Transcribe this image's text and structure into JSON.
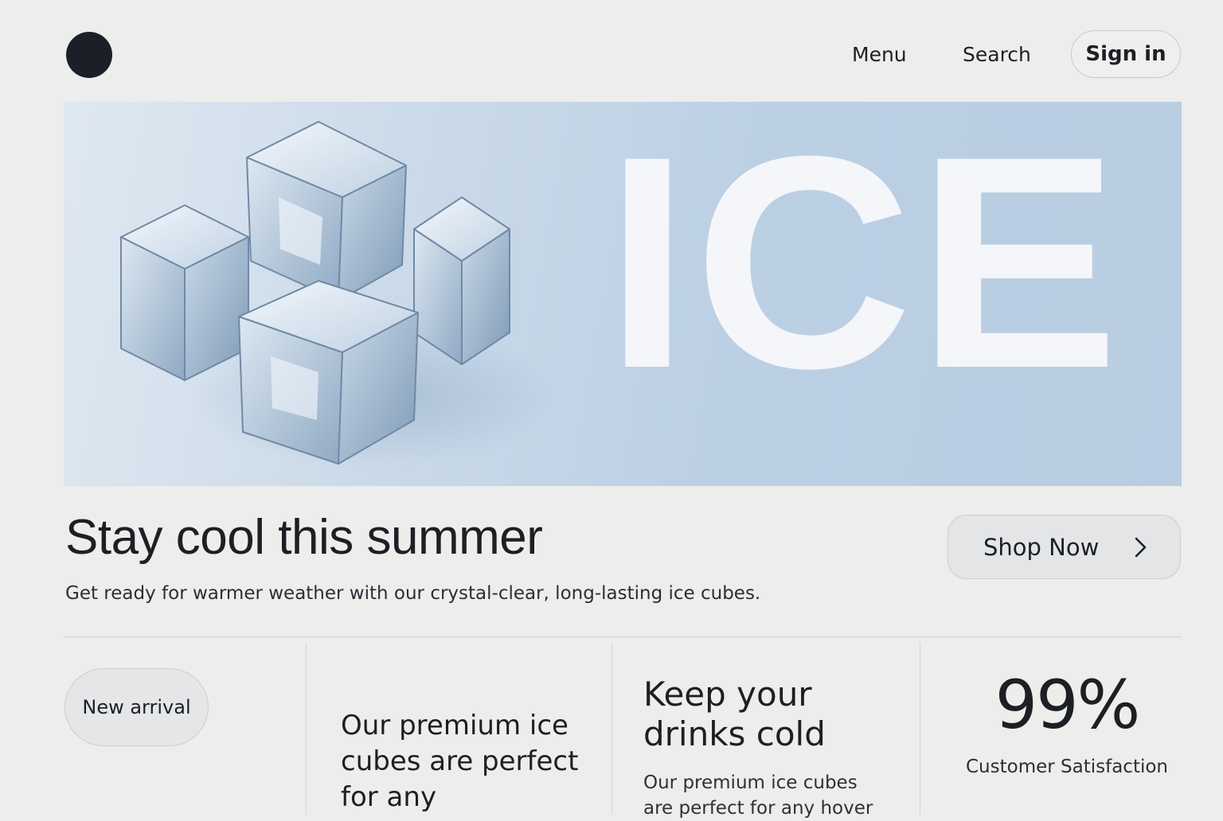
{
  "header": {
    "logo_icon": "circle-logo",
    "nav": {
      "menu": "Menu",
      "search": "Search"
    },
    "sign_in": "Sign in"
  },
  "hero": {
    "word": "ICE",
    "image": "ice-cubes-illustration"
  },
  "intro": {
    "title": "Stay cool this summer",
    "subtitle": "Get ready for warmer weather with our crystal-clear, long-lasting ice cubes.",
    "cta_label": "Shop Now",
    "cta_icon": "chevron-right-icon"
  },
  "features": {
    "badge": "New arrival",
    "col2_text": "Our premium ice cubes are perfect for any",
    "col3_title": "Keep your drinks cold",
    "col3_text": "Our premium ice cubes are perfect for any hover",
    "stat_value": "99%",
    "stat_label": "Customer Satisfaction"
  },
  "colors": {
    "background": "#ededec",
    "hero_blue": "#bcd0e4",
    "text": "#1c1f24"
  }
}
